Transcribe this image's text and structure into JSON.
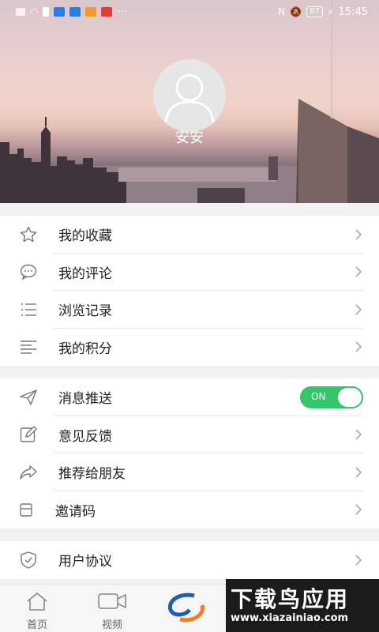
{
  "status_bar": {
    "time": "15:45",
    "battery": "87",
    "more": "···"
  },
  "profile": {
    "username": "安安"
  },
  "menu_section_1": [
    {
      "label": "我的收藏",
      "icon": "star-icon"
    },
    {
      "label": "我的评论",
      "icon": "comment-icon"
    },
    {
      "label": "浏览记录",
      "icon": "list-icon"
    },
    {
      "label": "我的积分",
      "icon": "lines-icon"
    }
  ],
  "menu_section_2": [
    {
      "label": "消息推送",
      "icon": "send-icon",
      "toggle": "ON"
    },
    {
      "label": "意见反馈",
      "icon": "edit-icon"
    },
    {
      "label": "推荐给朋友",
      "icon": "share-icon"
    },
    {
      "label": "邀请码",
      "icon": "box-icon"
    }
  ],
  "menu_section_3": [
    {
      "label": "用户协议",
      "icon": "shield-icon"
    }
  ],
  "tabbar": {
    "home": "首页",
    "video": "视频"
  },
  "watermark": {
    "title": "下载鸟应用",
    "url": "www.xiazainiao.com"
  },
  "colors": {
    "toggle_on": "#35c56a",
    "divider": "#e6e6e6",
    "background": "#f2f2f2"
  }
}
